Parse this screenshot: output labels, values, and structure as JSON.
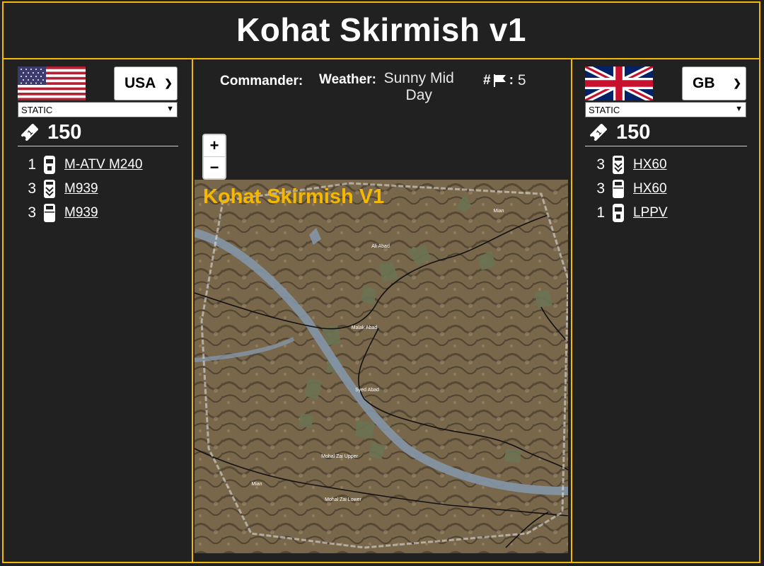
{
  "page": {
    "title": "Kohat Skirmish v1"
  },
  "left": {
    "nation": "USA",
    "mode": "STATIC",
    "points": "150",
    "units": [
      {
        "count": "1",
        "name": "M-ATV M240"
      },
      {
        "count": "3",
        "name": "M939"
      },
      {
        "count": "3",
        "name": "M939"
      }
    ]
  },
  "right": {
    "nation": "GB",
    "mode": "STATIC",
    "points": "150",
    "units": [
      {
        "count": "3",
        "name": "HX60"
      },
      {
        "count": "3",
        "name": "HX60"
      },
      {
        "count": "1",
        "name": "LPPV"
      }
    ]
  },
  "info": {
    "commander_label": "Commander:",
    "commander_value": "",
    "weather_label": "Weather:",
    "weather_value": "Sunny Mid Day",
    "flags_label": "#",
    "flags_value": "5"
  },
  "zoom": {
    "in": "+",
    "out": "−"
  },
  "map": {
    "title": "Kohat Skirmish V1",
    "places": [
      "Mian",
      "Ali Abad",
      "Malak Abad",
      "Syed Abad",
      "Mohal Zai Upper",
      "Mian",
      "Mohal Zai Lower"
    ]
  },
  "colors": {
    "accent": "#f5b800",
    "background": "#212121"
  },
  "icons": [
    "ticket-icon",
    "vehicle-icon",
    "flag-icon",
    "chevron-down-icon"
  ]
}
